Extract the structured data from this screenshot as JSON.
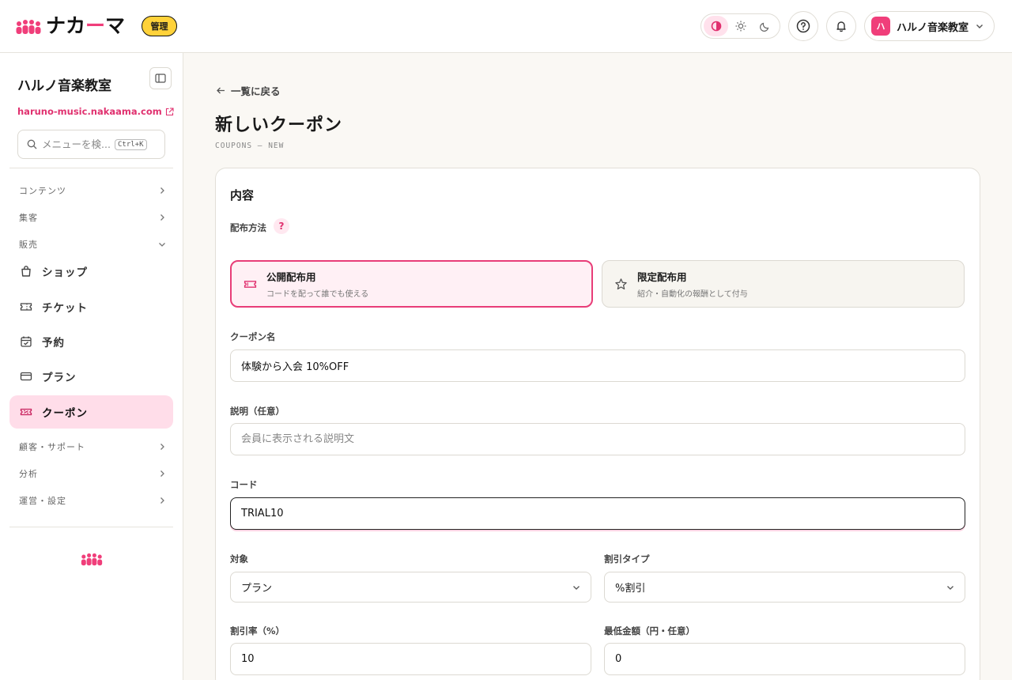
{
  "header": {
    "logo_text_pre": "ナカ",
    "logo_text_dash": "ー",
    "logo_text_post": "マ",
    "admin_badge": "管理",
    "account_avatar": "ハ",
    "account_name": "ハルノ音楽教室"
  },
  "sidebar": {
    "org_name": "ハルノ音楽教室",
    "org_url": "haruno-music.nakaama.com",
    "search_placeholder": "メニューを検...",
    "search_shortcut": "Ctrl+K",
    "groups": {
      "contents": "コンテンツ",
      "marketing": "集客",
      "sales": "販売",
      "customers": "顧客・サポート",
      "analytics": "分析",
      "operations": "運営・設定"
    },
    "items": {
      "shop": "ショップ",
      "ticket": "チケット",
      "reservation": "予約",
      "plan": "プラン",
      "coupon": "クーポン"
    }
  },
  "main": {
    "back_label": "一覧に戻る",
    "title": "新しいクーポン",
    "subtitle": "COUPONS — NEW",
    "section_title": "内容",
    "distribution_label": "配布方法",
    "help_glyph": "?",
    "options": [
      {
        "title": "公開配布用",
        "desc": "コードを配って誰でも使える",
        "selected": true
      },
      {
        "title": "限定配布用",
        "desc": "紹介・自動化の報酬として付与",
        "selected": false
      }
    ],
    "coupon_name_label": "クーポン名",
    "coupon_name_value": "体験から入会 10%OFF",
    "description_label": "説明（任意）",
    "description_placeholder": "会員に表示される説明文",
    "code_label": "コード",
    "code_value": "TRIAL10",
    "target_label": "対象",
    "target_value": "プラン",
    "discount_type_label": "割引タイプ",
    "discount_type_value": "%割引",
    "rate_label": "割引率（%）",
    "rate_value": "10",
    "min_amount_label": "最低金額（円・任意）",
    "min_amount_value": "0"
  },
  "colors": {
    "brand": "#f03e7a",
    "badge": "#ffd23a",
    "active_nav": "#ffdde9"
  }
}
